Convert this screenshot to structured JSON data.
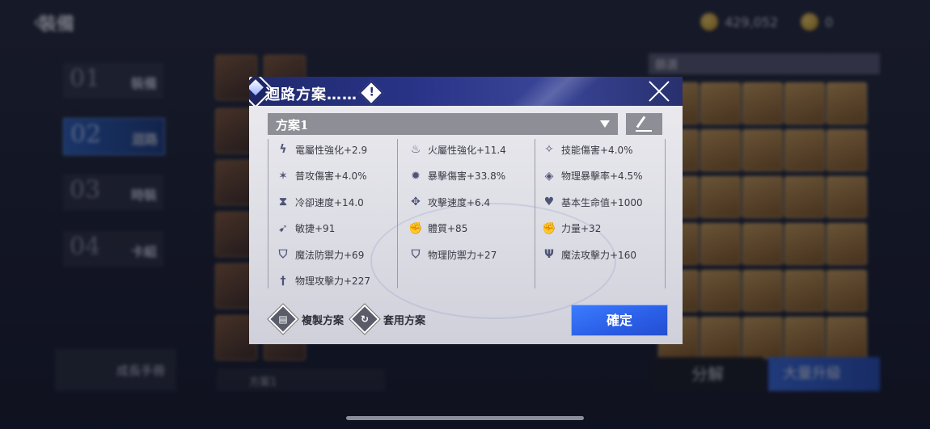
{
  "background": {
    "page_title": "裝備",
    "currency": [
      {
        "icon": "gold-coin-icon",
        "amount": "429,052"
      },
      {
        "icon": "gem-icon",
        "amount": "0"
      }
    ],
    "nav": [
      {
        "num": "01",
        "label": "裝備"
      },
      {
        "num": "02",
        "label": "迴路"
      },
      {
        "num": "03",
        "label": "時裝"
      },
      {
        "num": "04",
        "label": "卡組"
      }
    ],
    "manual_label": "成長手冊",
    "grid_filter": "篩選",
    "bottom_plan": "方案1",
    "decompose_label": "分解",
    "upgrade_label": "大量升級"
  },
  "dialog": {
    "title": "迴路方案……",
    "plan_selected": "方案1",
    "stats": [
      {
        "icon": "lightning-icon",
        "glyph": "ϟ",
        "text": "電屬性強化+2.9"
      },
      {
        "icon": "fire-icon",
        "glyph": "♨",
        "text": "火屬性強化+11.4"
      },
      {
        "icon": "skill-damage-icon",
        "glyph": "✧",
        "text": "技能傷害+4.0%"
      },
      {
        "icon": "normal-attack-icon",
        "glyph": "✶",
        "text": "普攻傷害+4.0%"
      },
      {
        "icon": "crit-damage-icon",
        "glyph": "✹",
        "text": "暴擊傷害+33.8%"
      },
      {
        "icon": "physical-crit-rate-icon",
        "glyph": "◈",
        "text": "物理暴擊率+4.5%"
      },
      {
        "icon": "hourglass-icon",
        "glyph": "⧗",
        "text": "冷卻速度+14.0"
      },
      {
        "icon": "attack-speed-icon",
        "glyph": "✥",
        "text": "攻擊速度+6.4"
      },
      {
        "icon": "heart-icon",
        "glyph": "♥",
        "text": "基本生命值+1000"
      },
      {
        "icon": "agility-icon",
        "glyph": "➹",
        "text": "敏捷+91"
      },
      {
        "icon": "vitality-icon",
        "glyph": "✊",
        "text": "體質+85"
      },
      {
        "icon": "strength-icon",
        "glyph": "✊",
        "text": "力量+32"
      },
      {
        "icon": "magic-defense-icon",
        "glyph": "⛉",
        "text": "魔法防禦力+69"
      },
      {
        "icon": "physical-defense-icon",
        "glyph": "⛉",
        "text": "物理防禦力+27"
      },
      {
        "icon": "magic-attack-icon",
        "glyph": "Ψ",
        "text": "魔法攻擊力+160"
      },
      {
        "icon": "physical-attack-icon",
        "glyph": "†",
        "text": "物理攻擊力+227"
      }
    ],
    "copy_label": "複製方案",
    "apply_label": "套用方案",
    "confirm_label": "確定"
  }
}
